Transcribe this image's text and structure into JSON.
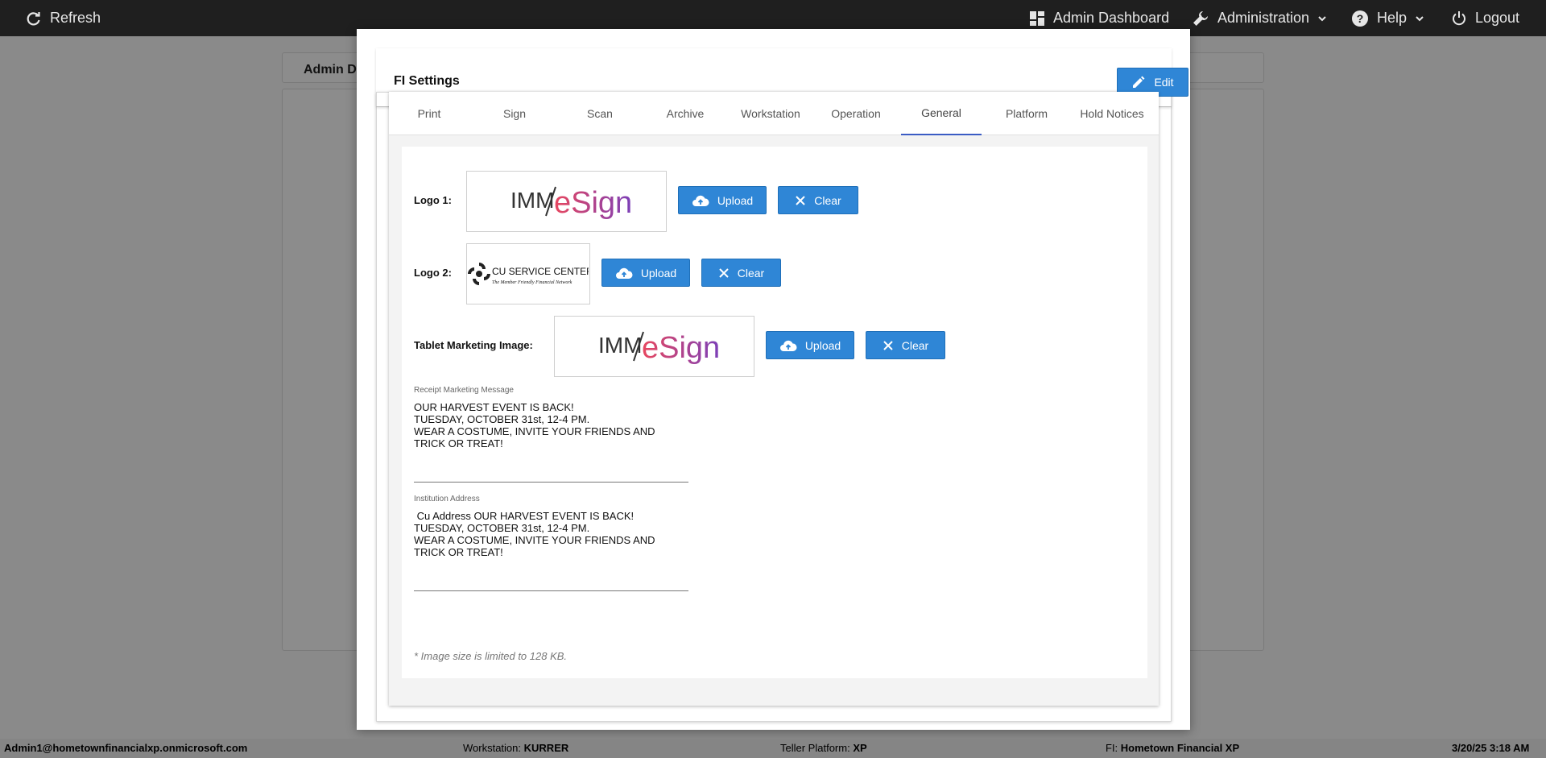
{
  "topbar": {
    "refresh_label": "Refresh",
    "admin_dashboard_label": "Admin Dashboard",
    "administration_label": "Administration",
    "help_label": "Help",
    "logout_label": "Logout"
  },
  "background": {
    "tab_label": "Admin D"
  },
  "modal": {
    "title": "FI Settings",
    "edit_label": "Edit",
    "tabs": [
      {
        "label": "Print"
      },
      {
        "label": "Sign"
      },
      {
        "label": "Scan"
      },
      {
        "label": "Archive"
      },
      {
        "label": "Workstation"
      },
      {
        "label": "Operation"
      },
      {
        "label": "General"
      },
      {
        "label": "Platform"
      },
      {
        "label": "Hold Notices"
      }
    ],
    "active_tab": "General",
    "general": {
      "logo1_label": "Logo 1:",
      "logo2_label": "Logo 2:",
      "tablet_label": "Tablet Marketing Image:",
      "upload_label": "Upload",
      "clear_label": "Clear",
      "logo_imm_text": "IMM",
      "logo_esign_text": "eSign",
      "logo_cu_text": "CU SERVICE CENTERS®",
      "logo_cu_tagline": "The Member Friendly Financial Network",
      "receipt_label": "Receipt Marketing Message",
      "receipt_value": "OUR HARVEST EVENT IS BACK!\nTUESDAY, OCTOBER 31st, 12-4 PM.\nWEAR A COSTUME, INVITE YOUR FRIENDS AND\nTRICK OR TREAT!",
      "address_label": "Institution Address",
      "address_value": " Cu Address OUR HARVEST EVENT IS BACK!\nTUESDAY, OCTOBER 31st, 12-4 PM.\nWEAR A COSTUME, INVITE YOUR FRIENDS AND\nTRICK OR TREAT!",
      "size_note": "* Image size is limited to 128 KB."
    }
  },
  "footer": {
    "user": "Admin1@hometownfinancialxp.onmicrosoft.com",
    "workstation_label": "Workstation:",
    "workstation_value": "KURRER",
    "platform_label": "Teller Platform:",
    "platform_value": "XP",
    "fi_label": "FI:",
    "fi_value": "Hometown Financial XP",
    "datetime": "3/20/25 3:18 AM"
  },
  "colors": {
    "accent_blue": "#2f86d6",
    "active_tab_underline": "#3b5cc4",
    "topbar_bg": "#1f1f1f"
  }
}
